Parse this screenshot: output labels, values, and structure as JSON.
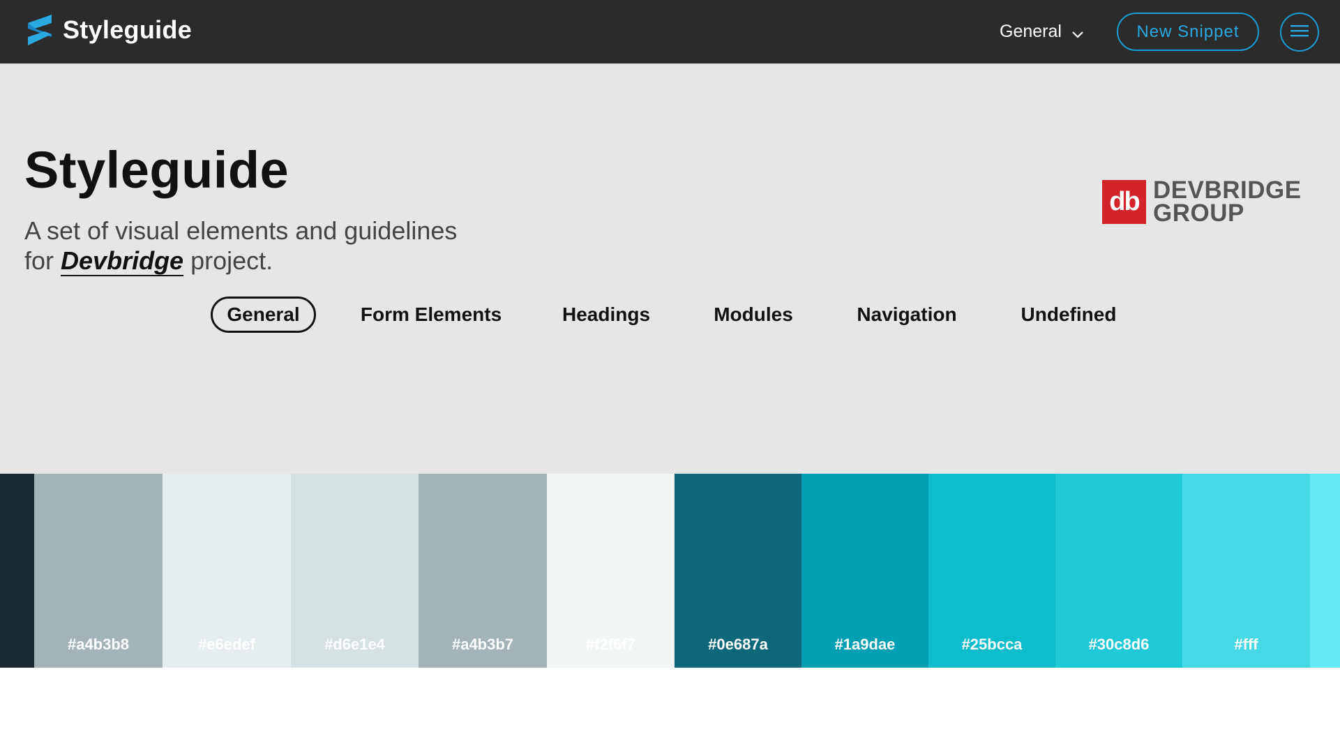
{
  "header": {
    "brand_name": "Styleguide",
    "brand_icon": "styleguide-s-logo",
    "category_select": "General",
    "new_snippet_label": "New Snippet",
    "menu_icon": "hamburger-menu-icon",
    "accent_color": "#1a9dd6"
  },
  "hero": {
    "title": "Styleguide",
    "subtitle_line1": "A set of visual elements and guidelines",
    "subtitle_for": "for",
    "subtitle_project": "Devbridge",
    "subtitle_end": "project.",
    "logo_mark": "db",
    "logo_line1": "DEVBRIDGE",
    "logo_line2": "GROUP",
    "logo_color": "#d3232a"
  },
  "tabs": [
    {
      "label": "General",
      "active": true
    },
    {
      "label": "Form Elements",
      "active": false
    },
    {
      "label": "Headings",
      "active": false
    },
    {
      "label": "Modules",
      "active": false
    },
    {
      "label": "Navigation",
      "active": false
    },
    {
      "label": "Undefined",
      "active": false
    }
  ],
  "palette": [
    {
      "color": "#1c2a33",
      "label": ""
    },
    {
      "color": "#a4b3b8",
      "label": "#a4b3b8"
    },
    {
      "color": "#e6edef",
      "label": "#e6edef"
    },
    {
      "color": "#d6e1e4",
      "label": "#d6e1e4"
    },
    {
      "color": "#a4b3b7",
      "label": "#a4b3b7"
    },
    {
      "color": "#f2f6f7",
      "label": "#f2f6f7"
    },
    {
      "color": "#0e687a",
      "label": "#0e687a"
    },
    {
      "color": "#009fb3",
      "label": "#1a9dae"
    },
    {
      "color": "#0dbdcd",
      "label": "#25bcca"
    },
    {
      "color": "#1fc9d8",
      "label": "#30c8d6"
    },
    {
      "color": "#47d8e6",
      "label": "#fff"
    },
    {
      "color": "#63e8f4",
      "label": ""
    }
  ]
}
